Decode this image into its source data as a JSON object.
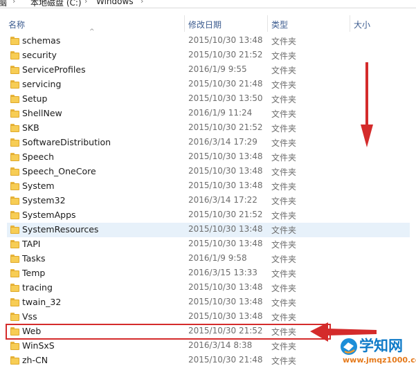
{
  "breadcrumb": {
    "items": [
      "脑",
      "本地磁盘 (C:)",
      "Windows"
    ]
  },
  "columns": {
    "name": "名称",
    "date": "修改日期",
    "type": "类型",
    "size": "大小"
  },
  "rows": [
    {
      "name": "schemas",
      "date": "2015/10/30 13:48",
      "type": "文件夹"
    },
    {
      "name": "security",
      "date": "2015/10/30 21:52",
      "type": "文件夹"
    },
    {
      "name": "ServiceProfiles",
      "date": "2016/1/9 9:55",
      "type": "文件夹"
    },
    {
      "name": "servicing",
      "date": "2015/10/30 21:48",
      "type": "文件夹"
    },
    {
      "name": "Setup",
      "date": "2015/10/30 13:50",
      "type": "文件夹"
    },
    {
      "name": "ShellNew",
      "date": "2016/1/9 11:24",
      "type": "文件夹"
    },
    {
      "name": "SKB",
      "date": "2015/10/30 21:52",
      "type": "文件夹"
    },
    {
      "name": "SoftwareDistribution",
      "date": "2016/3/14 17:29",
      "type": "文件夹"
    },
    {
      "name": "Speech",
      "date": "2015/10/30 13:48",
      "type": "文件夹"
    },
    {
      "name": "Speech_OneCore",
      "date": "2015/10/30 13:48",
      "type": "文件夹"
    },
    {
      "name": "System",
      "date": "2015/10/30 13:48",
      "type": "文件夹"
    },
    {
      "name": "System32",
      "date": "2016/3/14 17:22",
      "type": "文件夹"
    },
    {
      "name": "SystemApps",
      "date": "2015/10/30 21:52",
      "type": "文件夹"
    },
    {
      "name": "SystemResources",
      "date": "2015/10/30 13:48",
      "type": "文件夹"
    },
    {
      "name": "TAPI",
      "date": "2015/10/30 13:48",
      "type": "文件夹"
    },
    {
      "name": "Tasks",
      "date": "2016/1/9 9:58",
      "type": "文件夹"
    },
    {
      "name": "Temp",
      "date": "2016/3/15 13:33",
      "type": "文件夹"
    },
    {
      "name": "tracing",
      "date": "2015/10/30 13:48",
      "type": "文件夹"
    },
    {
      "name": "twain_32",
      "date": "2015/10/30 13:48",
      "type": "文件夹"
    },
    {
      "name": "Vss",
      "date": "2015/10/30 13:48",
      "type": "文件夹"
    },
    {
      "name": "Web",
      "date": "2015/10/30 21:52",
      "type": "文件夹"
    },
    {
      "name": "WinSxS",
      "date": "2016/3/14 8:38",
      "type": "文件夹"
    },
    {
      "name": "zh-CN",
      "date": "2015/10/30 21:48",
      "type": "文件夹"
    }
  ],
  "hovered_row": "SystemResources",
  "marked_row": "Web",
  "icons": {
    "folder": "folder-icon",
    "annotation_down": "red-arrow-down",
    "annotation_left": "red-arrow-left"
  },
  "colors": {
    "annotation": "#d42b2b",
    "folder": "#f7cd55",
    "hover": "#e7f1fa",
    "header_text": "#3b5b8f"
  },
  "watermark": {
    "title": "学知网",
    "url": "www.jmqz1000.com"
  }
}
